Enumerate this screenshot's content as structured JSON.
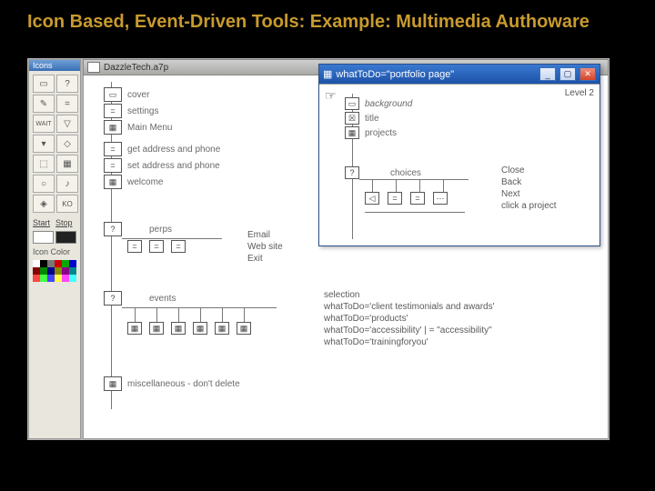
{
  "title": "Icon Based, Event-Driven Tools: Example: Multimedia Authoware",
  "palette": {
    "header": "Icons",
    "start": "Start",
    "stop": "Stop",
    "iconColor": "Icon Color"
  },
  "canvas": {
    "docTitle": "DazzleTech.a7p",
    "flow": {
      "cover": "cover",
      "settings": "settings",
      "mainMenu": "Main Menu",
      "getAddr": "get address and phone",
      "setAddr": "set address and phone",
      "welcome": "welcome",
      "perps": "perps",
      "events": "events",
      "misc": "miscellaneous - don't delete"
    },
    "perpOptions": {
      "email": "Email",
      "web": "Web site",
      "exit": "Exit"
    },
    "selection": {
      "heading": "selection",
      "l1": "whatToDo='client testimonials and awards'",
      "l2": "whatToDo='products'",
      "l3": "whatToDo='accessibility' | = \"accessibility\"",
      "l4": "whatToDo='trainingforyou'"
    }
  },
  "popup": {
    "title": "whatToDo=\"portfolio page\"",
    "level": "Level 2",
    "items": {
      "background": "background",
      "title": "title",
      "projects": "projects",
      "choices": "choices"
    },
    "rightList": {
      "close": "Close",
      "back": "Back",
      "next": "Next",
      "click": "click a project"
    }
  }
}
